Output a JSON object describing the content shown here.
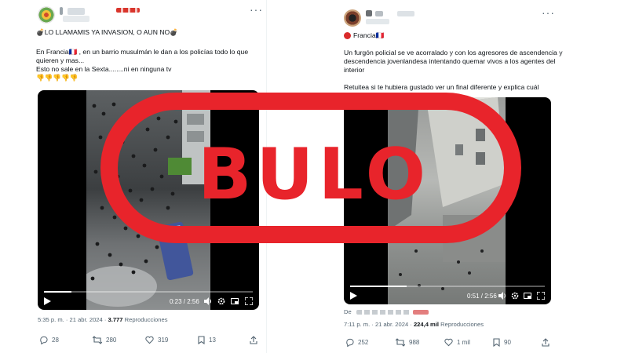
{
  "left_tweet": {
    "heading": "💣LO LLAMAMIS YA INVASION, O AUN NO💣",
    "body_lines": [
      "En Francia🇫🇷 , en un barrio musulmán le dan a los policías todo lo que",
      "quieren y mas...",
      "Esto no sale en la Sexta........ni en ninguna tv",
      "👎👎👎👎👎"
    ],
    "video": {
      "time": "0:23 / 2:56",
      "progress": 0.13
    },
    "meta": {
      "posted": "5:35 p. m. · 21 abr. 2024 · ",
      "views": "3.777",
      "views_label": " Reproducciones"
    },
    "actions": {
      "replies": "28",
      "reposts": "280",
      "likes": "319",
      "bookmarks": "13"
    }
  },
  "right_tweet": {
    "location": "Francia🇫🇷",
    "body_lines": [
      "Un furgón policial se ve acorralado y con los agresores de ascendencia y",
      "descendencia joven​landesa intentando quemar vivos a los agentes del",
      "interior"
    ],
    "extra_line": "Retuitea si te hubiera gustado ver un final diferente y explica cuál",
    "video": {
      "time": "0:51 / 2:56",
      "progress": 0.29
    },
    "from_label": "De",
    "meta": {
      "posted": "7:11 p. m. · 21 abr. 2024 · ",
      "views": "224,4 mil",
      "views_label": " Reproducciones"
    },
    "actions": {
      "replies": "252",
      "reposts": "988",
      "likes": "1 mil",
      "bookmarks": "90"
    }
  },
  "stamp": {
    "text": "BULO",
    "color": "#e8242b"
  },
  "icons": {
    "reply": "reply-icon",
    "repost": "repost-icon",
    "like": "heart-icon",
    "bookmark": "bookmark-icon",
    "share": "share-icon",
    "more": "more-icon",
    "play": "play-icon",
    "volume": "volume-icon",
    "settings": "gear-icon",
    "pip": "picture-in-picture-icon",
    "fullscreen": "fullscreen-icon"
  }
}
